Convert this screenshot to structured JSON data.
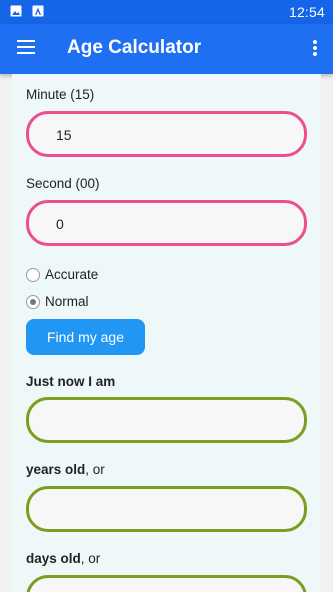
{
  "status_bar": {
    "time": "12:54",
    "icons": [
      "image-icon",
      "a-notification-icon"
    ]
  },
  "app_bar": {
    "title": "Age Calculator",
    "menu_icon": "hamburger-menu-icon",
    "more_icon": "more-vert-icon"
  },
  "form": {
    "minute": {
      "label": "Minute (15)",
      "value": "15"
    },
    "second": {
      "label": "Second (00)",
      "value": "0"
    },
    "options": [
      {
        "label": "Accurate",
        "checked": false
      },
      {
        "label": "Normal",
        "checked": true
      }
    ],
    "submit_label": "Find my age"
  },
  "results": {
    "just_now_label": "Just now I am",
    "years": {
      "bold": "years old",
      "rest": ", or",
      "value": ""
    },
    "days": {
      "bold": "days old",
      "rest": ", or",
      "value": ""
    }
  },
  "colors": {
    "app_bar": "#1e6ff2",
    "status_bar": "#1565e8",
    "pink_border": "#ee4d8e",
    "green_border": "#7a9e1e",
    "button": "#2196f3"
  }
}
